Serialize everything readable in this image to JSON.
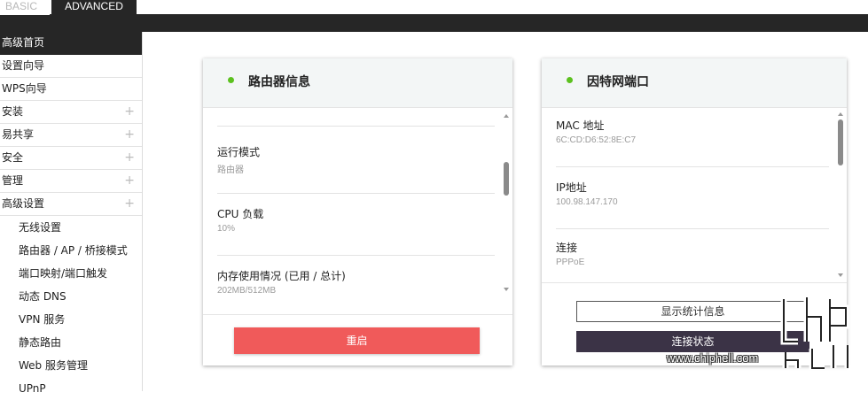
{
  "tabs": {
    "basic": "BASIC",
    "advanced": "ADVANCED"
  },
  "sidebar": {
    "items": [
      {
        "label": "高级首页",
        "expandable": false,
        "active": true
      },
      {
        "label": "设置向导",
        "expandable": false
      },
      {
        "label": "WPS向导",
        "expandable": false
      },
      {
        "label": "安装",
        "expandable": true
      },
      {
        "label": "易共享",
        "expandable": true
      },
      {
        "label": "安全",
        "expandable": true
      },
      {
        "label": "管理",
        "expandable": true
      },
      {
        "label": "高级设置",
        "expandable": true
      }
    ],
    "sub_items": [
      "无线设置",
      "路由器 / AP / 桥接模式",
      "端口映射/端口触发",
      "动态 DNS",
      "VPN 服务",
      "静态路由",
      "Web 服务管理",
      "UPnP"
    ],
    "plus_symbol": "+"
  },
  "router_card": {
    "title": "路由器信息",
    "fields": [
      {
        "label": "运行模式",
        "value": "路由器"
      },
      {
        "label": "CPU 负载",
        "value": "10%"
      },
      {
        "label": "内存使用情况 (已用 / 总计)",
        "value": "202MB/512MB"
      }
    ],
    "reboot_button": "重启"
  },
  "internet_card": {
    "title": "因特网端口",
    "fields": [
      {
        "label": "MAC 地址",
        "value": "6C:CD:D6:52:8E:C7"
      },
      {
        "label": "IP地址",
        "value": "100.98.147.170"
      },
      {
        "label": "连接",
        "value": "PPPoE"
      }
    ],
    "stats_button": "显示统计信息",
    "status_button": "连接状态"
  },
  "watermark": {
    "url": "www.chiphell.com"
  },
  "colors": {
    "topbar": "#262626",
    "status_dot": "#5cc11f",
    "reboot": "#f05a5a",
    "status_button": "#3b3346"
  }
}
